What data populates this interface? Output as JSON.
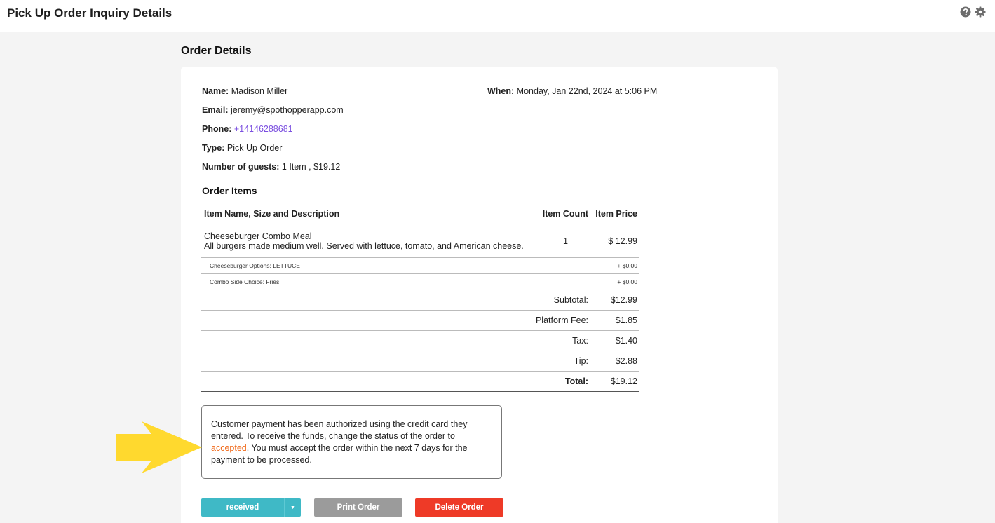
{
  "header": {
    "title": "Pick Up Order Inquiry Details",
    "icons": [
      "help-circle-icon",
      "gear-icon"
    ]
  },
  "section_title": "Order Details",
  "order": {
    "name_label": "Name:",
    "name_value": "Madison Miller",
    "when_label": "When:",
    "when_value": "Monday, Jan 22nd, 2024 at 5:06 PM",
    "email_label": "Email:",
    "email_value": "jeremy@spothopperapp.com",
    "phone_label": "Phone:",
    "phone_value": "+14146288681",
    "type_label": "Type:",
    "type_value": "Pick Up Order",
    "guests_label": "Number of guests:",
    "guests_value": "1 Item , $19.12"
  },
  "items_heading": "Order Items",
  "table": {
    "headers": [
      "Item Name, Size and Description",
      "Item Count",
      "Item Price"
    ],
    "item": {
      "name": "Cheeseburger Combo Meal",
      "description": "All burgers made medium well. Served with lettuce, tomato, and American cheese.",
      "count": "1",
      "price": "$ 12.99"
    },
    "options": [
      {
        "label": "Cheeseburger Options: LETTUCE",
        "price": "+ $0.00"
      },
      {
        "label": "Combo Side Choice: Fries",
        "price": "+ $0.00"
      }
    ],
    "summary": [
      {
        "label": "Subtotal:",
        "value": "$12.99"
      },
      {
        "label": "Platform Fee:",
        "value": "$1.85"
      },
      {
        "label": "Tax:",
        "value": "$1.40"
      },
      {
        "label": "Tip:",
        "value": "$2.88"
      }
    ],
    "total_label": "Total:",
    "total_value": "$19.12"
  },
  "notice": {
    "text_before": "Customer payment has been authorized using the credit card they entered. To receive the funds, change the status of the order to ",
    "highlight": "accepted",
    "text_after": ". You must accept the order within the next 7 days for the payment to be processed."
  },
  "actions": {
    "status_value": "received",
    "print_label": "Print Order",
    "delete_label": "Delete Order"
  },
  "colors": {
    "status_button": "#3fb9c6",
    "print_button": "#9b9b9b",
    "delete_button": "#ee3a27",
    "phone_link": "#7b4fe0",
    "highlight": "#f06a1b",
    "arrow": "#ffd92e"
  }
}
